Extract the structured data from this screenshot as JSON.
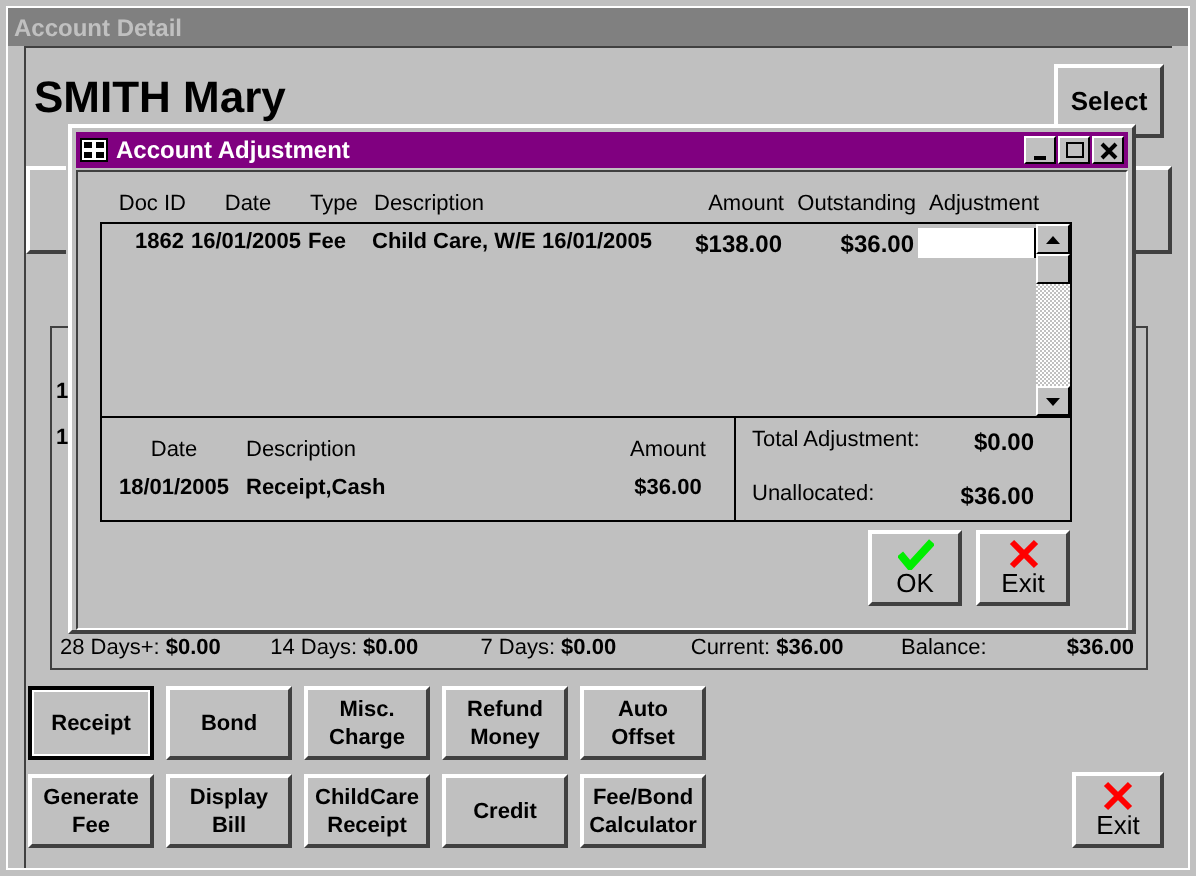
{
  "window": {
    "title": "Account Detail"
  },
  "client_name": "SMITH Mary",
  "select_button": {
    "label": "Select"
  },
  "background_marks": [
    "1",
    "1"
  ],
  "summary": [
    {
      "label": "28 Days+:",
      "value": "$0.00"
    },
    {
      "label": "14 Days:",
      "value": "$0.00"
    },
    {
      "label": "7 Days:",
      "value": "$0.00"
    },
    {
      "label": "Current:",
      "value": "$36.00"
    },
    {
      "label": "Balance:",
      "value": "$36.00"
    }
  ],
  "button_rows": [
    {
      "buttons": [
        {
          "label": "Receipt",
          "default": true
        },
        {
          "label": "Bond",
          "default": false
        },
        {
          "label": "Misc.\nCharge",
          "default": false
        },
        {
          "label": "Refund\nMoney",
          "default": false
        },
        {
          "label": "Auto\nOffset",
          "default": false
        }
      ]
    },
    {
      "buttons": [
        {
          "label": "Generate\nFee",
          "default": false
        },
        {
          "label": "Display\nBill",
          "default": false
        },
        {
          "label": "ChildCare\nReceipt",
          "default": false
        },
        {
          "label": "Credit",
          "default": false
        },
        {
          "label": "Fee/Bond\nCalculator",
          "default": false
        }
      ]
    }
  ],
  "exit_button": {
    "label": "Exit"
  },
  "dialog": {
    "title": "Account Adjustment",
    "columns": [
      "Doc ID",
      "Date",
      "Type",
      "Description",
      "Amount",
      "Outstanding",
      "Adjustment"
    ],
    "rows": [
      {
        "doc_id": "1862",
        "date": "16/01/2005",
        "type": "Fee",
        "description": "Child Care, W/E 16/01/2005",
        "amount": "$138.00",
        "outstanding": "$36.00"
      }
    ],
    "receipt": {
      "columns": [
        "Date",
        "Description",
        "Amount"
      ],
      "date": "18/01/2005",
      "description": "Receipt,Cash",
      "amount": "$36.00"
    },
    "totals": [
      {
        "label": "Total Adjustment:",
        "value": "$0.00"
      },
      {
        "label": "Unallocated:",
        "value": "$36.00"
      }
    ],
    "buttons": [
      {
        "kind": "ok",
        "label": "OK"
      },
      {
        "kind": "exit",
        "label": "Exit"
      }
    ]
  }
}
